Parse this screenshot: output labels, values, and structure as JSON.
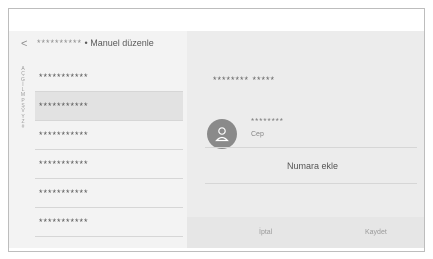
{
  "header": {
    "masked_name": "**********",
    "separator": "•",
    "title": "Manuel düzenle",
    "back_icon": "chevron-left-icon"
  },
  "alphabet_index": [
    "A",
    "Ç",
    "G",
    "İ",
    "L",
    "M",
    "P",
    "Ş",
    "V",
    "Y",
    "Z",
    "#"
  ],
  "contacts": [
    {
      "label": "***********"
    },
    {
      "label": "***********"
    },
    {
      "label": "***********"
    },
    {
      "label": "***********"
    },
    {
      "label": "***********"
    },
    {
      "label": "***********"
    }
  ],
  "selected_index": 1,
  "detail": {
    "name_masked": "********  *****",
    "avatar_icon": "person-icon",
    "phone_masked": "********",
    "phone_type": "Cep",
    "add_number": "Numara ekle"
  },
  "footer": {
    "cancel": "İptal",
    "save": "Kaydet"
  }
}
